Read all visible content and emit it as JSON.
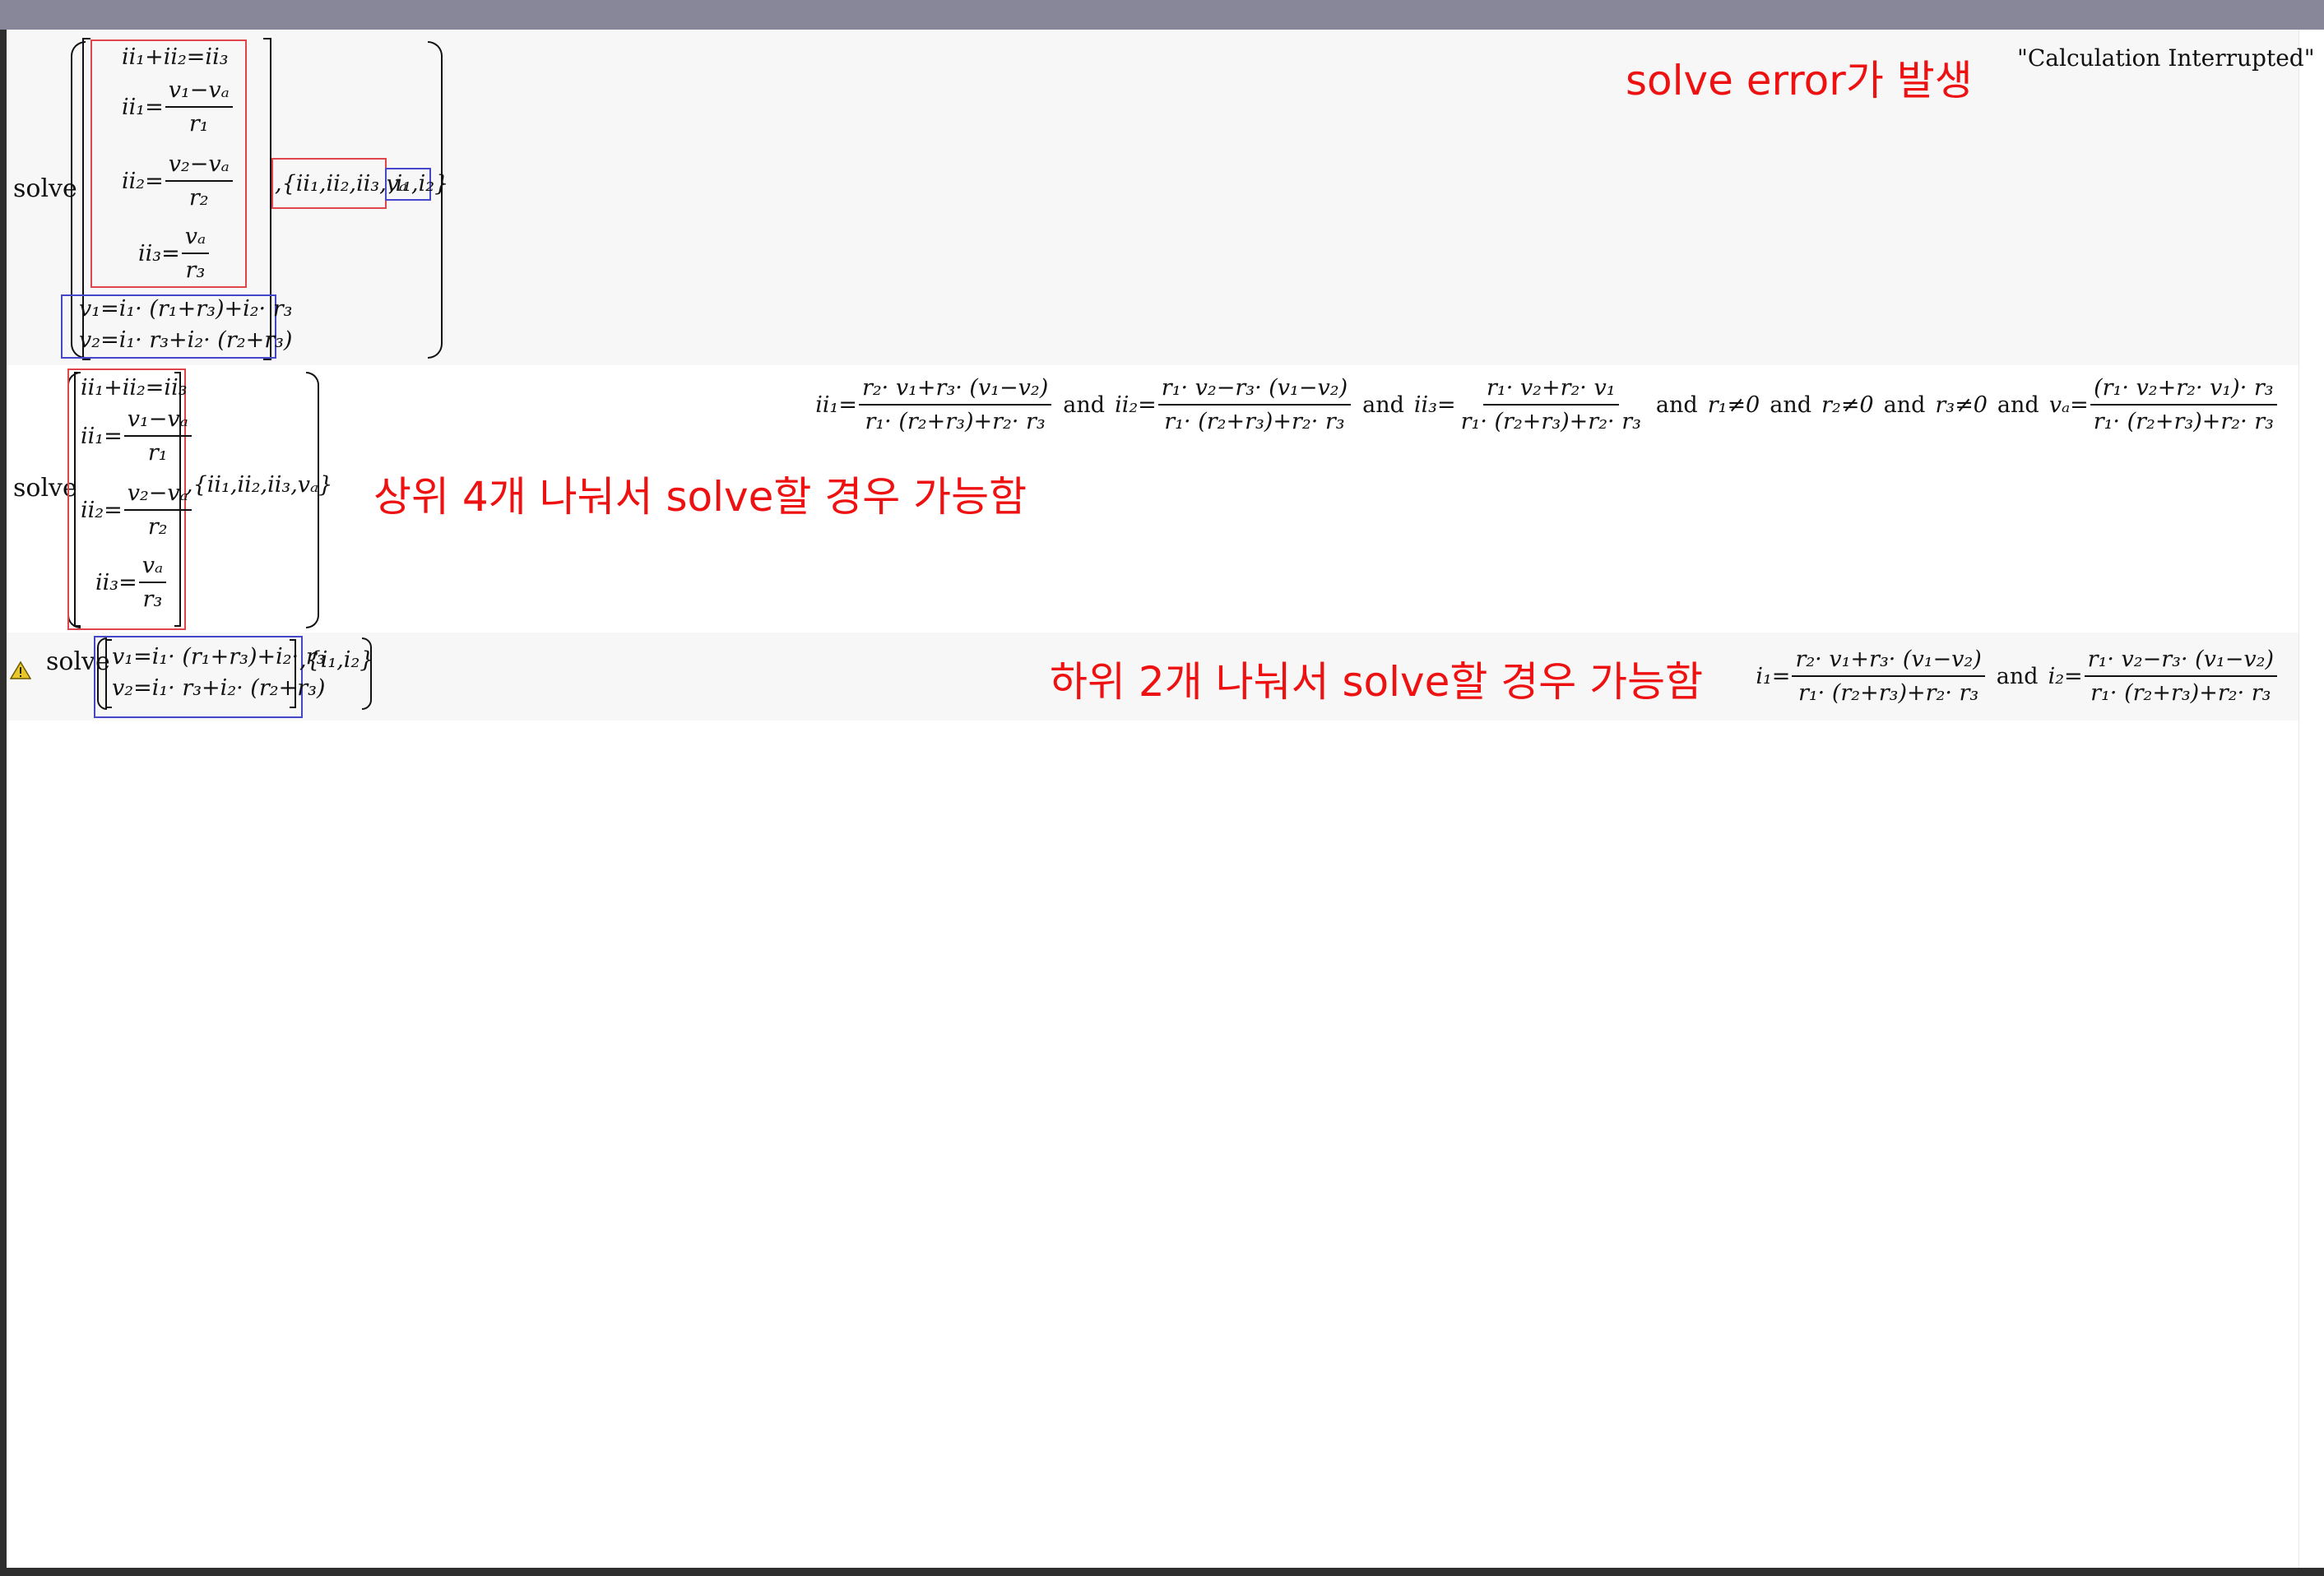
{
  "section1": {
    "fn": "solve",
    "eqs": [
      "ii₁+ii₂=ii₃"
    ],
    "eq_ii1_lhs": "ii₁=",
    "eq_ii1_num": "v₁−vₐ",
    "eq_ii1_den": "r₁",
    "eq_ii2_lhs": "ii₂=",
    "eq_ii2_num": "v₂−vₐ",
    "eq_ii2_den": "r₂",
    "eq_ii3_lhs": "ii₃=",
    "eq_ii3_num": "vₐ",
    "eq_ii3_den": "r₃",
    "eq_v1": "v₁=i₁· (r₁+r₃)+i₂· r₃",
    "eq_v2": "v₂=i₁· r₃+i₂· (r₂+r₃)",
    "vars_red": ",{ii₁,ii₂,ii₃,vₐ",
    "vars_blue": ",i₁,i₂}",
    "error_note": "solve error가 발생",
    "result": "\"Calculation Interrupted\""
  },
  "section2": {
    "fn": "solve",
    "eq_sum": "ii₁+ii₂=ii₃",
    "eq_ii1_lhs": "ii₁=",
    "eq_ii1_num": "v₁−vₐ",
    "eq_ii1_den": "r₁",
    "eq_ii2_lhs": "ii₂=",
    "eq_ii2_num": "v₂−vₐ",
    "eq_ii2_den": "r₂",
    "eq_ii3_lhs": "ii₃=",
    "eq_ii3_num": "vₐ",
    "eq_ii3_den": "r₃",
    "vars": ",{ii₁,ii₂,ii₃,vₐ}",
    "note": "상위 4개 나눠서 solve할 경우 가능함",
    "res_ii1_lhs": "ii₁=",
    "res_ii1_num": "r₂· v₁+r₃· (v₁−v₂)",
    "res_ii1_den": "r₁· (r₂+r₃)+r₂· r₃",
    "res_ii2_lhs": "ii₂=",
    "res_ii2_num": "r₁· v₂−r₃· (v₁−v₂)",
    "res_ii2_den": "r₁· (r₂+r₃)+r₂· r₃",
    "res_ii3_lhs": "ii₃=",
    "res_ii3_num": "r₁· v₂+r₂· v₁",
    "res_ii3_den": "r₁· (r₂+r₃)+r₂· r₃",
    "cond_r1": "r₁≠0",
    "cond_r2": "r₂≠0",
    "cond_r3": "r₃≠0",
    "res_va_lhs": "vₐ=",
    "res_va_num": "(r₁· v₂+r₂· v₁)· r₃",
    "res_va_den": "r₁· (r₂+r₃)+r₂· r₃",
    "and": "and"
  },
  "section3": {
    "fn": "solve",
    "eq_v1": "v₁=i₁· (r₁+r₃)+i₂· r₃",
    "eq_v2": "v₂=i₁· r₃+i₂· (r₂+r₃)",
    "vars": ",{i₁,i₂}",
    "note": "하위 2개 나눠서 solve할 경우 가능함",
    "res_i1_lhs": "i₁=",
    "res_i1_num": "r₂· v₁+r₃· (v₁−v₂)",
    "res_i1_den": "r₁· (r₂+r₃)+r₂· r₃",
    "res_i2_lhs": "i₂=",
    "res_i2_num": "r₁· v₂−r₃· (v₁−v₂)",
    "res_i2_den": "r₁· (r₂+r₃)+r₂· r₃",
    "and": "and"
  },
  "icons": {
    "warning": "warning-triangle-icon"
  },
  "colors": {
    "annotation_red": "#ee1111",
    "box_red": "#e0454b",
    "box_blue": "#4646c8",
    "titlebar": "#878799"
  }
}
